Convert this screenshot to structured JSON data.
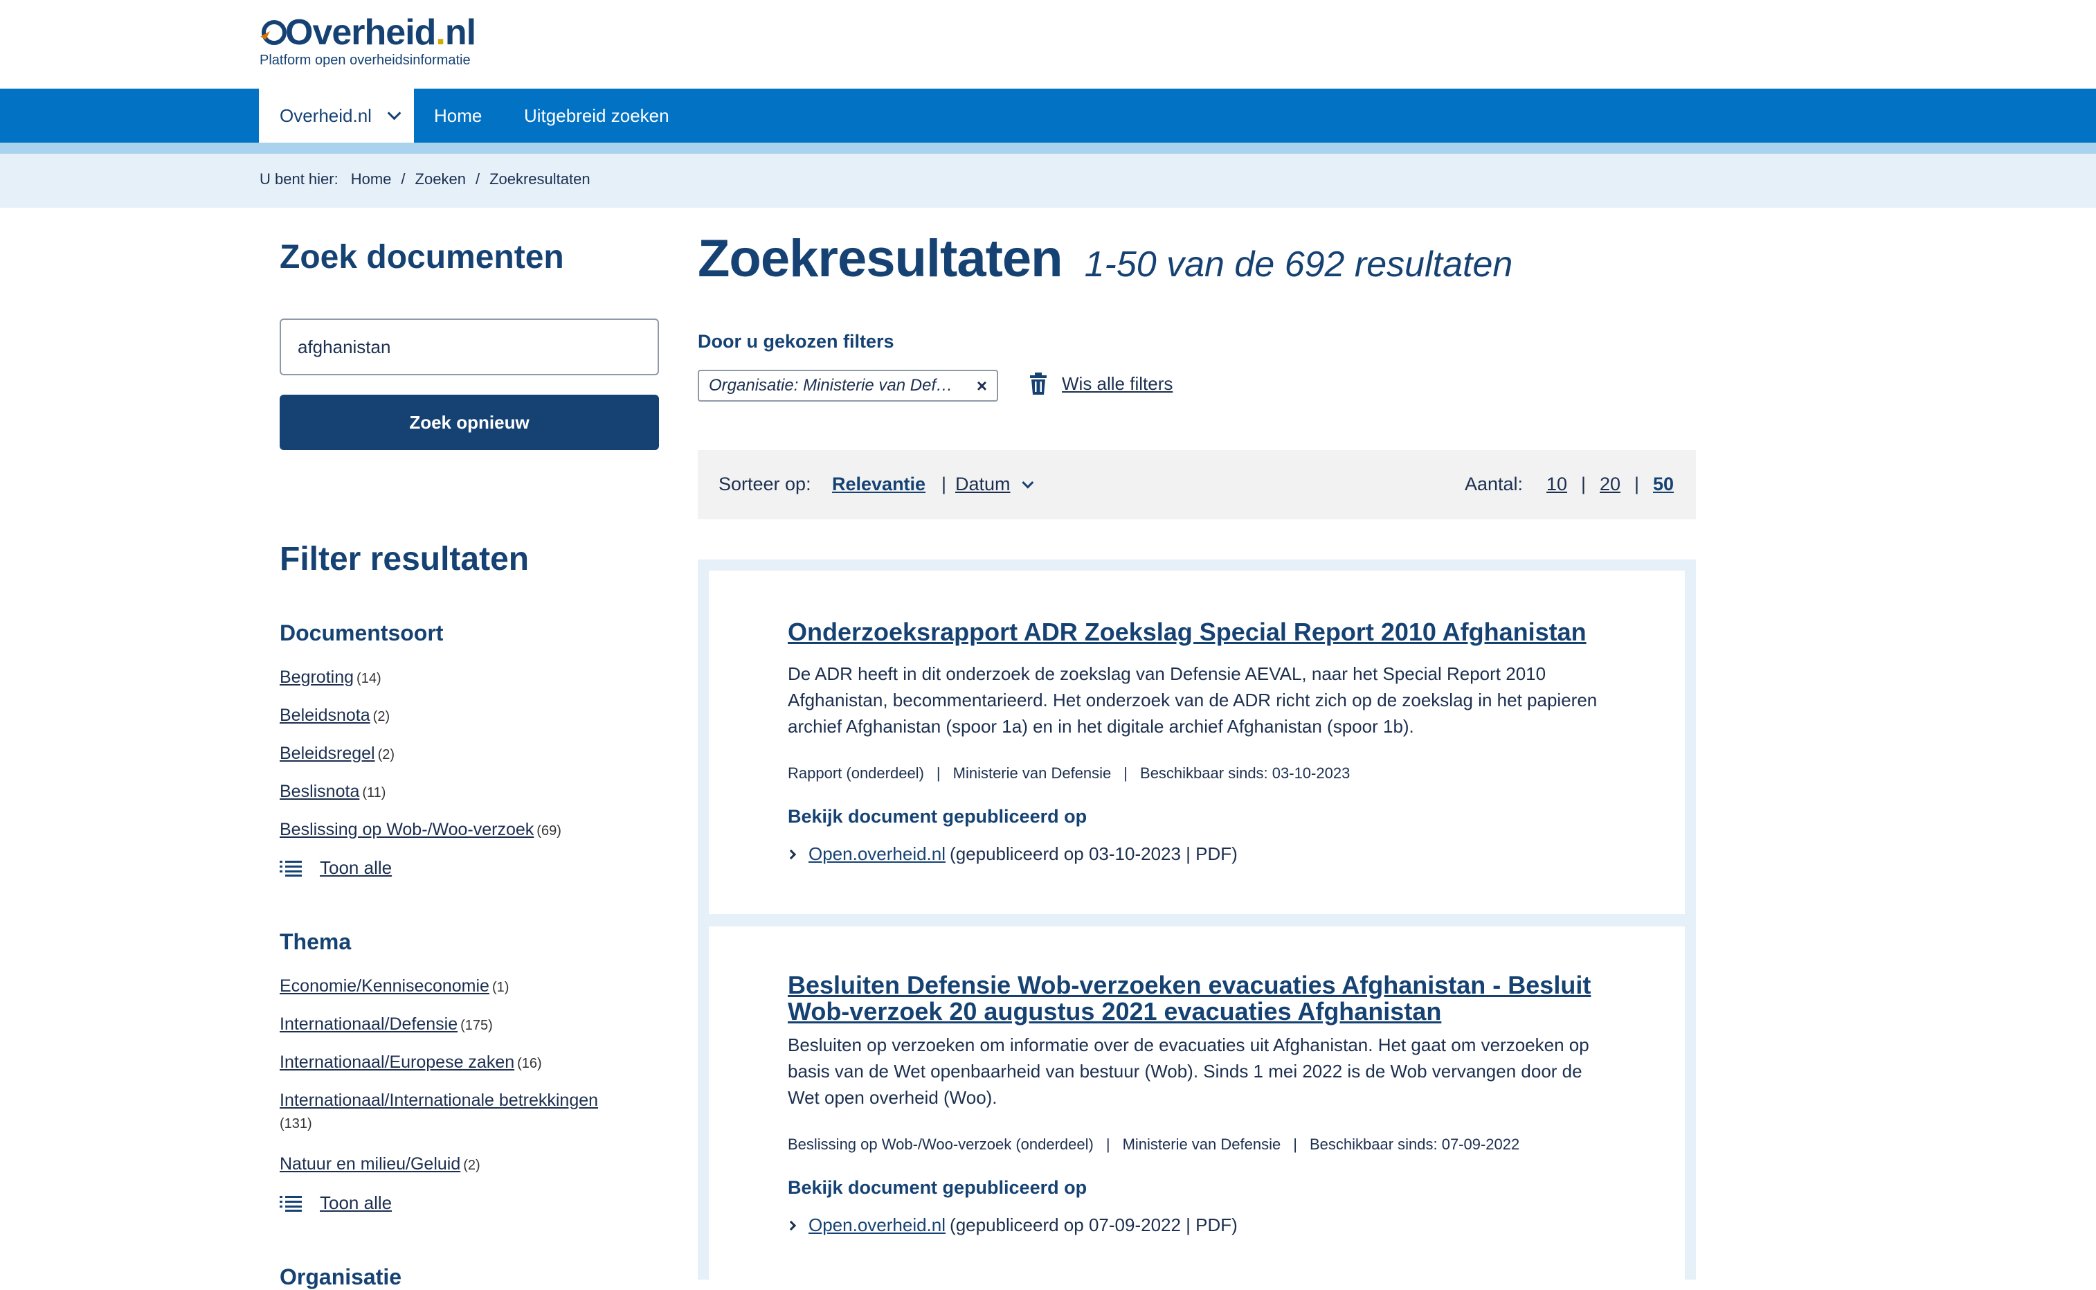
{
  "header": {
    "logo_text_main": "Overheid",
    "logo_text_dot": ".",
    "logo_text_nl": "nl",
    "tagline": "Platform open overheidsinformatie"
  },
  "nav": {
    "items": [
      {
        "label": "Overheid.nl"
      },
      {
        "label": "Home"
      },
      {
        "label": "Uitgebreid zoeken"
      }
    ]
  },
  "breadcrumb": {
    "label": "U bent hier:",
    "items": [
      "Home",
      "Zoeken",
      "Zoekresultaten"
    ],
    "separator": "/"
  },
  "search": {
    "title": "Zoek documenten",
    "value": "afghanistan",
    "button_label": "Zoek opnieuw"
  },
  "filters": {
    "title": "Filter resultaten",
    "documentsoort": {
      "title": "Documentsoort",
      "items": [
        {
          "label": "Begroting",
          "count": "(14)"
        },
        {
          "label": "Beleidsnota",
          "count": "(2)"
        },
        {
          "label": "Beleidsregel",
          "count": "(2)"
        },
        {
          "label": "Beslisnota",
          "count": "(11)"
        },
        {
          "label": "Beslissing op Wob-/Woo-verzoek",
          "count": "(69)"
        }
      ],
      "show_all": "Toon alle"
    },
    "thema": {
      "title": "Thema",
      "items": [
        {
          "label": "Economie/Kenniseconomie",
          "count": "(1)"
        },
        {
          "label": "Internationaal/Defensie",
          "count": "(175)"
        },
        {
          "label": "Internationaal/Europese zaken",
          "count": "(16)"
        },
        {
          "label": "Internationaal/Internationale betrekkingen",
          "count": "(131)"
        },
        {
          "label": "Natuur en milieu/Geluid",
          "count": "(2)"
        }
      ],
      "show_all": "Toon alle"
    },
    "organisatie": {
      "title": "Organisatie"
    }
  },
  "results": {
    "title": "Zoekresultaten",
    "count_text": "1-50 van de 692 resultaten",
    "chosen_filters_label": "Door u gekozen filters",
    "active_filter": "Organisatie: Ministerie van Defensie",
    "clear_filters": "Wis alle filters",
    "sort": {
      "label": "Sorteer op:",
      "relevance": "Relevantie",
      "separator": "|",
      "date": "Datum"
    },
    "page_size": {
      "label": "Aantal:",
      "options": [
        "10",
        "20",
        "50"
      ],
      "selected": "50"
    },
    "items": [
      {
        "title": "Onderzoeksrapport ADR Zoekslag Special Report 2010 Afghanistan",
        "description": "De ADR heeft in dit onderzoek de zoekslag van Defensie AEVAL, naar het Special Report 2010 Afghanistan, becommentarieerd. Het onderzoek van de ADR richt zich op de zoekslag in het papieren archief Afghanistan (spoor 1a) en in het digitale archief Afghanistan (spoor 1b).",
        "meta_type": "Rapport (onderdeel)",
        "meta_org": "Ministerie van Defensie",
        "meta_date": "Beschikbaar sinds: 03-10-2023",
        "view_label": "Bekijk document gepubliceerd op",
        "link_text": "Open.overheid.nl",
        "link_suffix": "(gepubliceerd op 03-10-2023 | PDF)"
      },
      {
        "title": "Besluiten Defensie Wob-verzoeken evacuaties Afghanistan - Besluit Wob-verzoek 20 augustus 2021 evacuaties Afghanistan",
        "description": "Besluiten op verzoeken om informatie over de evacuaties uit Afghanistan. Het gaat om verzoeken op basis van de Wet openbaarheid van bestuur (Wob). Sinds 1 mei 2022 is de Wob vervangen door de Wet open overheid (Woo).",
        "meta_type": "Beslissing op Wob-/Woo-verzoek (onderdeel)",
        "meta_org": "Ministerie van Defensie",
        "meta_date": "Beschikbaar sinds: 07-09-2022",
        "view_label": "Bekijk document gepubliceerd op",
        "link_text": "Open.overheid.nl",
        "link_suffix": "(gepubliceerd op 07-09-2022 | PDF)"
      }
    ]
  },
  "colors": {
    "brand_dark": "#154273",
    "nav_blue": "#0172c4",
    "light_blue_bg": "#e5f0f9",
    "accent_yellow": "#d4a900"
  }
}
